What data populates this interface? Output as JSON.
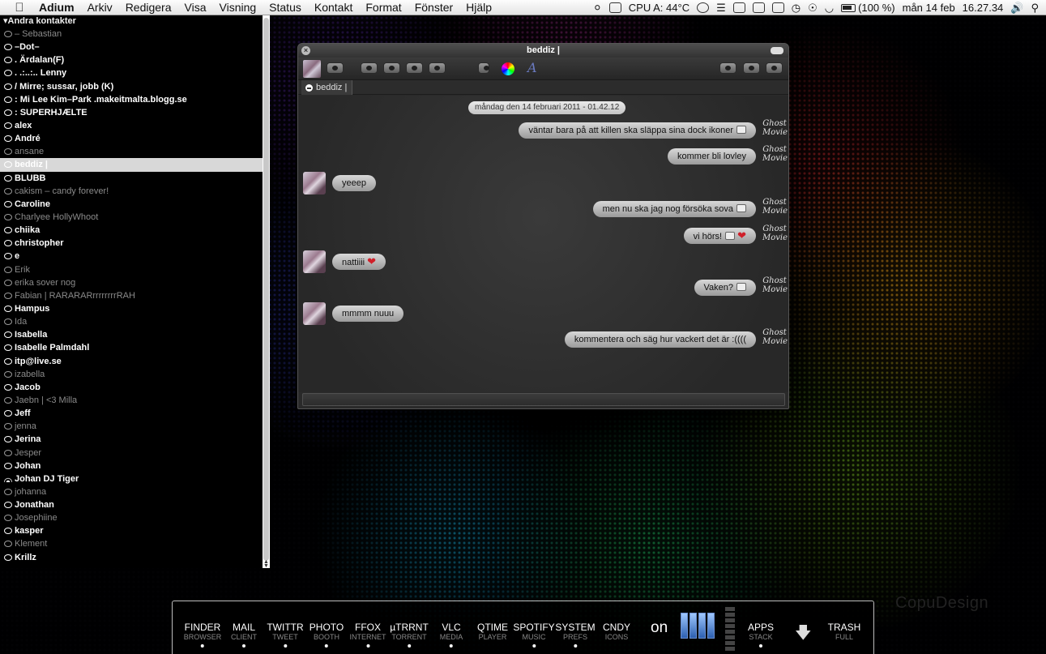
{
  "menubar": {
    "app_name": "Adium",
    "menus": [
      "Arkiv",
      "Redigera",
      "Visa",
      "Visning",
      "Status",
      "Kontakt",
      "Format",
      "Fönster",
      "Hjälp"
    ],
    "cpu": "CPU A: 44°C",
    "battery": "(100 %)",
    "date": "mån 14 feb",
    "time": "16.27.34"
  },
  "contacts": {
    "group": "Andra kontakter",
    "items": [
      {
        "name": "– Sebastian",
        "status": "away"
      },
      {
        "name": "–Dot–",
        "status": "online"
      },
      {
        "name": ".                        Ärdalan(F)",
        "status": "online"
      },
      {
        "name": ".     .:..:..           Lenny",
        "status": "online"
      },
      {
        "name": "/ Mirre; sussar, jobb (K)",
        "status": "online"
      },
      {
        "name": ": Mi Lee Kim–Park          .makeitmalta.blogg.se",
        "status": "online"
      },
      {
        "name": ": SUPERHJÆLTE",
        "status": "online"
      },
      {
        "name": "alex",
        "status": "online"
      },
      {
        "name": "André",
        "status": "online"
      },
      {
        "name": "ansane",
        "status": "away"
      },
      {
        "name": "beddiz |",
        "status": "selected"
      },
      {
        "name": "BLUBB",
        "status": "online"
      },
      {
        "name": "cakism  –  candy forever!",
        "status": "away"
      },
      {
        "name": "Caroline",
        "status": "online"
      },
      {
        "name": "Charlyee HollyWhoot",
        "status": "away"
      },
      {
        "name": "chiika",
        "status": "online"
      },
      {
        "name": "christopher",
        "status": "online"
      },
      {
        "name": "e",
        "status": "online"
      },
      {
        "name": "Erik",
        "status": "away"
      },
      {
        "name": "erika sover nog",
        "status": "away"
      },
      {
        "name": "Fabian | RARARARrrrrrrrrRAH",
        "status": "away"
      },
      {
        "name": "Hampus",
        "status": "online"
      },
      {
        "name": "Ida",
        "status": "away"
      },
      {
        "name": "Isabella",
        "status": "online"
      },
      {
        "name": "Isabelle Palmdahl",
        "status": "online"
      },
      {
        "name": "itp@live.se",
        "status": "online"
      },
      {
        "name": "izabella",
        "status": "away"
      },
      {
        "name": "Jacob",
        "status": "online"
      },
      {
        "name": "Jaebn | <3 Milla",
        "status": "away"
      },
      {
        "name": "Jeff",
        "status": "online"
      },
      {
        "name": "jenna",
        "status": "away"
      },
      {
        "name": "Jerina",
        "status": "online"
      },
      {
        "name": "Jesper",
        "status": "away"
      },
      {
        "name": "Johan",
        "status": "online"
      },
      {
        "name": "Johan DJ Tiger",
        "status": "online-wifi"
      },
      {
        "name": "johanna",
        "status": "away"
      },
      {
        "name": "Jonathan",
        "status": "online"
      },
      {
        "name": "Josephiine",
        "status": "away"
      },
      {
        "name": "kasper",
        "status": "online"
      },
      {
        "name": "Klement",
        "status": "away"
      },
      {
        "name": "Krillz",
        "status": "online"
      }
    ]
  },
  "chat": {
    "title": "beddiz |",
    "tab_label": "beddiz |",
    "date_stamp": "måndag den 14 februari 2011 - 01.42.12",
    "messages": [
      {
        "dir": "out",
        "text": "väntar bara på att killen ska släppa sina dock ikoner",
        "emoji": "emo"
      },
      {
        "dir": "out",
        "text": "kommer bli lovley",
        "emoji": ""
      },
      {
        "dir": "in",
        "text": "yeeep",
        "emoji": ""
      },
      {
        "dir": "out",
        "text": "men nu ska jag nog försöka sova",
        "emoji": "emo"
      },
      {
        "dir": "out",
        "text": "vi hörs!",
        "emoji": "emo-heart"
      },
      {
        "dir": "in",
        "text": "nattiiii",
        "emoji": "heart"
      },
      {
        "dir": "out",
        "text": "Vaken?",
        "emoji": "emo"
      },
      {
        "dir": "in",
        "text": "mmmm nuuu",
        "emoji": ""
      },
      {
        "dir": "out",
        "text": "kommentera och säg hur vackert det är :((((",
        "emoji": ""
      }
    ],
    "avatar_right_text": "Ghost Movie"
  },
  "dock": {
    "items": [
      {
        "main": "FINDER",
        "sub": "BROWSER",
        "running": true
      },
      {
        "main": "MAIL",
        "sub": "CLIENT",
        "running": true
      },
      {
        "main": "TWITTR",
        "sub": "TWEET",
        "running": true
      },
      {
        "main": "PHOTO",
        "sub": "BOOTH",
        "running": true
      },
      {
        "main": "FFOX",
        "sub": "INTERNET",
        "running": true
      },
      {
        "main": "µTRRNT",
        "sub": "TORRENT",
        "running": true
      },
      {
        "main": "VLC",
        "sub": "MEDIA",
        "running": true
      },
      {
        "main": "QTIME",
        "sub": "PLAYER",
        "running": false
      },
      {
        "main": "SPOTIFY",
        "sub": "MUSIC",
        "running": true
      },
      {
        "main": "SYSTEM",
        "sub": "PREFS",
        "running": true
      },
      {
        "main": "CNDY",
        "sub": "ICONS",
        "running": false
      },
      {
        "main": "APPS",
        "sub": "STACK",
        "running": true
      },
      {
        "main": "TRASH",
        "sub": "FULL",
        "running": false
      }
    ],
    "on_label": "on"
  },
  "wallpaper": {
    "brand": "CopuDesign"
  }
}
